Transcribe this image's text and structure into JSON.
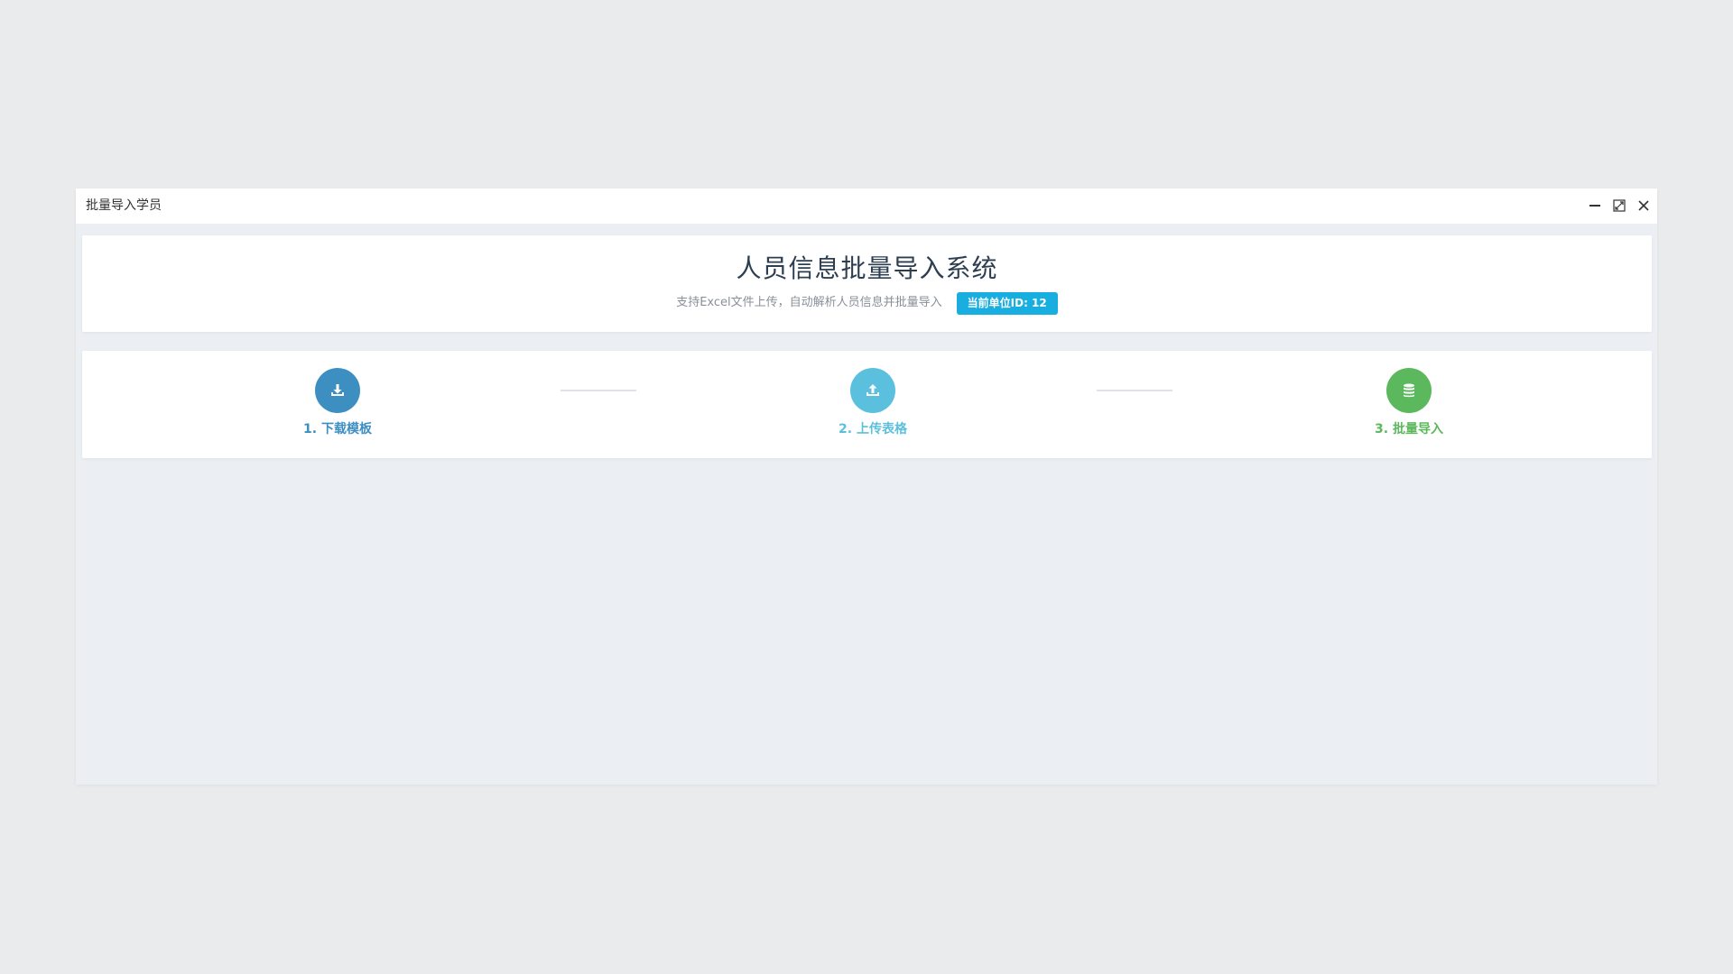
{
  "window": {
    "title": "批量导入学员",
    "controls": [
      "minimize-icon",
      "maximize-icon",
      "close-icon"
    ]
  },
  "header": {
    "title": "人员信息批量导入系统",
    "subtitle": "支持Excel文件上传，自动解析人员信息并批量导入",
    "unit_badge": "当前单位ID: 12"
  },
  "steps": [
    {
      "label": "1. 下载模板",
      "icon": "download-icon",
      "color": "#3d8fc2"
    },
    {
      "label": "2. 上传表格",
      "icon": "upload-icon",
      "color": "#5bc0de"
    },
    {
      "label": "3. 批量导入",
      "icon": "database-icon",
      "color": "#5cb85c"
    }
  ],
  "colors": {
    "badge_bg": "#18aee0",
    "title_text": "#2c3e50",
    "subtitle_text": "#8a8f99"
  }
}
